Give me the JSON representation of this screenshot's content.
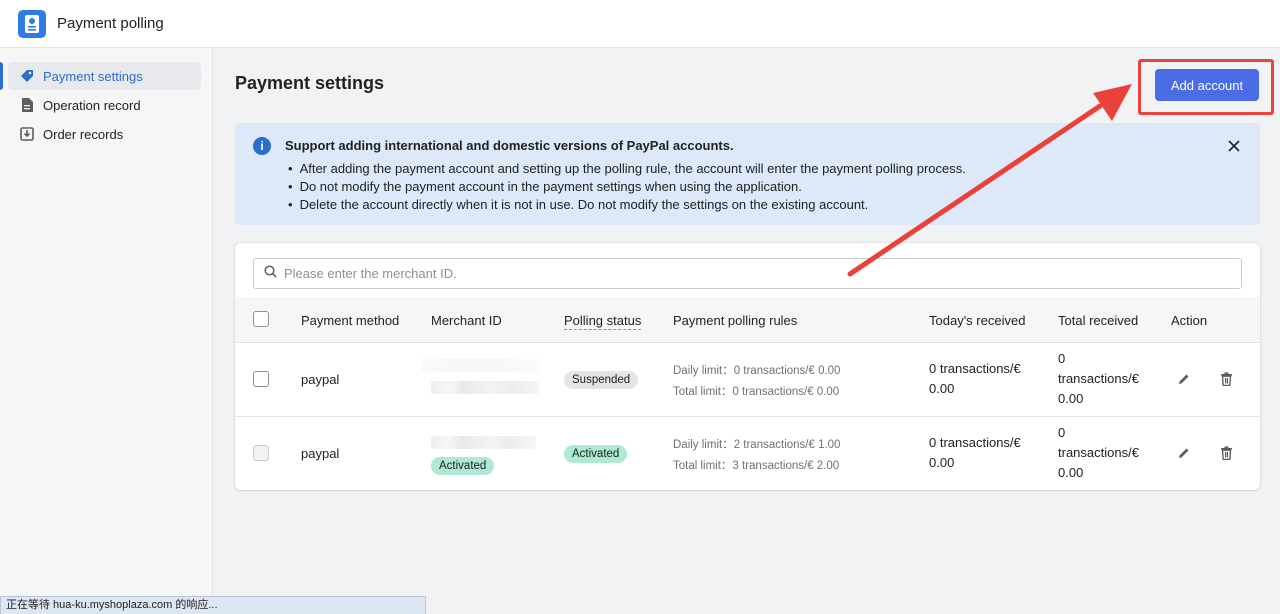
{
  "app": {
    "title": "Payment polling"
  },
  "sidebar": {
    "items": [
      {
        "label": "Payment settings",
        "icon": "tag-dollar-icon",
        "active": true
      },
      {
        "label": "Operation record",
        "icon": "document-icon",
        "active": false
      },
      {
        "label": "Order records",
        "icon": "import-icon",
        "active": false
      }
    ]
  },
  "page": {
    "title": "Payment settings",
    "add_button_label": "Add account"
  },
  "banner": {
    "title": "Support adding international and domestic versions of PayPal accounts.",
    "items": [
      "After adding the payment account and setting up the polling rule, the account will enter the payment polling process.",
      "Do not modify the payment account in the payment settings when using the application.",
      "Delete the account directly when it is not in use. Do not modify the settings on the existing account."
    ]
  },
  "search": {
    "placeholder": "Please enter the merchant ID."
  },
  "table": {
    "headers": {
      "payment_method": "Payment method",
      "merchant_id": "Merchant ID",
      "polling_status": "Polling status",
      "rules": "Payment polling rules",
      "today_received": "Today's received",
      "total_received": "Total received",
      "action": "Action"
    },
    "rows": [
      {
        "payment_method": "paypal",
        "merchant_badge": "",
        "status": "Suspended",
        "daily_limit": "Daily limit：0 transactions/€ 0.00",
        "total_limit": "Total limit：0 transactions/€ 0.00",
        "today_received": "0 transactions/€\n0.00",
        "total_received": "0\ntransactions/€\n0.00"
      },
      {
        "payment_method": "paypal",
        "merchant_badge": "Activated",
        "status": "Activated",
        "daily_limit": "Daily limit：2 transactions/€ 1.00",
        "total_limit": "Total limit：3 transactions/€ 2.00",
        "today_received": "0 transactions/€\n0.00",
        "total_received": "0\ntransactions/€\n0.00"
      }
    ]
  },
  "status_bar": {
    "text": "正在等待 hua-ku.myshoplaza.com 的响应..."
  },
  "colors": {
    "accent": "#4a6de5",
    "highlight": "#e8423b",
    "banner_bg": "#dde9f9",
    "activated": "#aee9d1"
  }
}
